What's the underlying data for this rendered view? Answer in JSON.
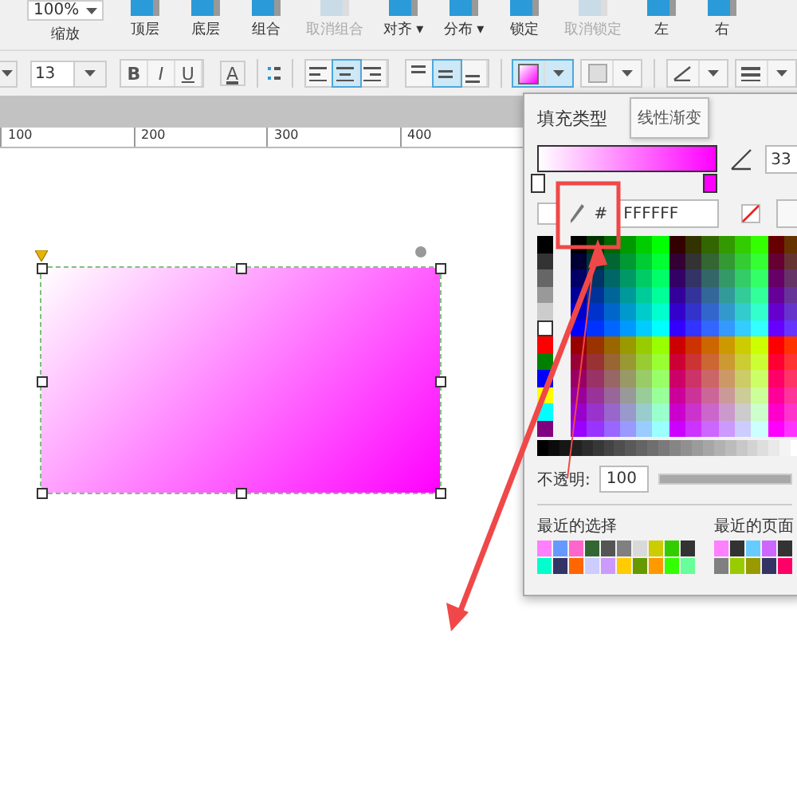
{
  "toolbar": {
    "zoom": {
      "value": "100%",
      "label": "缩放"
    },
    "tools": [
      {
        "label": "顶层",
        "disabled": false
      },
      {
        "label": "底层",
        "disabled": false
      },
      {
        "label": "组合",
        "disabled": false
      },
      {
        "label": "取消组合",
        "disabled": true
      },
      {
        "label": "对齐",
        "disabled": false,
        "menu_marker": "▾"
      },
      {
        "label": "分布",
        "disabled": false,
        "menu_marker": "▾"
      },
      {
        "label": "锁定",
        "disabled": false
      },
      {
        "label": "取消锁定",
        "disabled": true
      },
      {
        "label": "左",
        "disabled": false
      },
      {
        "label": "右",
        "disabled": false
      }
    ]
  },
  "format_bar": {
    "font_size": "13",
    "styles": [
      "B",
      "I",
      "U"
    ],
    "text_color": "A",
    "h_align": [
      {
        "selected": false
      },
      {
        "selected": true
      },
      {
        "selected": false
      }
    ],
    "v_align": [
      {
        "selected": false
      },
      {
        "selected": true
      },
      {
        "selected": false
      }
    ],
    "fill_selected": true
  },
  "ruler": [
    "100",
    "200",
    "300",
    "400"
  ],
  "fill_panel": {
    "title": "填充类型",
    "tooltip": "线性渐变",
    "angle": "33",
    "hex_prefix": "#",
    "hex": "FFFFFF",
    "opacity_label": "不透明:",
    "opacity": "100",
    "opacity_slider": {
      "level": 1
    },
    "recent_selected": {
      "label": "最近的选择",
      "swatches": [
        {
          "color": "#ff80ff"
        },
        {
          "color": "#6699ff"
        },
        {
          "color": "#ff66cc"
        },
        {
          "color": "#336633"
        },
        {
          "color": "#555555"
        },
        {
          "color": "#808080"
        },
        {
          "color": "#d9d9d9"
        },
        {
          "color": "#cccc00"
        },
        {
          "color": "#33cc00"
        },
        {
          "color": "#333333"
        },
        {
          "color": "#00ffcc"
        },
        {
          "color": "#333366"
        },
        {
          "color": "#ff6600"
        },
        {
          "color": "#ccccff"
        },
        {
          "color": "#cc99ff"
        },
        {
          "color": "#ffcc00"
        },
        {
          "color": "#669900"
        },
        {
          "color": "#ff9900"
        },
        {
          "color": "#33ff00"
        },
        {
          "color": "#66ff99"
        }
      ]
    },
    "recent_page": {
      "label": "最近的页面",
      "swatches": [
        {
          "color": "#ff80ff"
        },
        {
          "color": "#333333"
        },
        {
          "color": "#66ccff"
        },
        {
          "color": "#cc66ff"
        },
        {
          "color": "#333333"
        },
        {
          "color": "#808080"
        },
        {
          "color": "#99cc00"
        },
        {
          "color": "#999900"
        },
        {
          "color": "#333366"
        },
        {
          "color": "#ff0066"
        }
      ]
    }
  }
}
